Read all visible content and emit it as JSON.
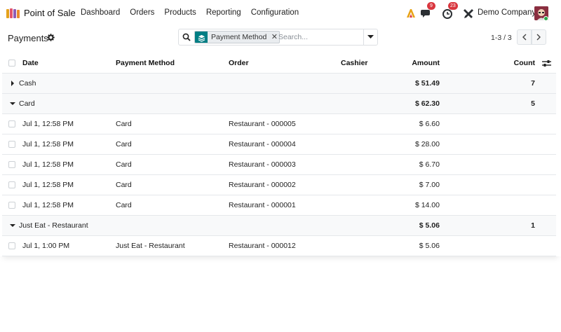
{
  "app": {
    "name": "Point of Sale",
    "menu": [
      "Dashboard",
      "Orders",
      "Products",
      "Reporting",
      "Configuration"
    ]
  },
  "systray": {
    "messages_badge": "9",
    "activities_badge": "23",
    "company": "Demo Company"
  },
  "control_panel": {
    "title": "Payments",
    "search": {
      "facet_label": "Payment Method",
      "placeholder": "Search..."
    },
    "pager": "1-3 / 3"
  },
  "list": {
    "columns": {
      "date": "Date",
      "payment_method": "Payment Method",
      "order": "Order",
      "cashier": "Cashier",
      "amount": "Amount",
      "count": "Count"
    },
    "groups": [
      {
        "name": "Cash",
        "expanded": false,
        "amount": "$ 51.49",
        "count": "7",
        "records": []
      },
      {
        "name": "Card",
        "expanded": true,
        "amount": "$ 62.30",
        "count": "5",
        "records": [
          {
            "date": "Jul 1, 12:58 PM",
            "method": "Card",
            "order": "Restaurant - 000005",
            "amount": "$ 6.60"
          },
          {
            "date": "Jul 1, 12:58 PM",
            "method": "Card",
            "order": "Restaurant - 000004",
            "amount": "$ 28.00"
          },
          {
            "date": "Jul 1, 12:58 PM",
            "method": "Card",
            "order": "Restaurant - 000003",
            "amount": "$ 6.70"
          },
          {
            "date": "Jul 1, 12:58 PM",
            "method": "Card",
            "order": "Restaurant - 000002",
            "amount": "$ 7.00"
          },
          {
            "date": "Jul 1, 12:58 PM",
            "method": "Card",
            "order": "Restaurant - 000001",
            "amount": "$ 14.00"
          }
        ]
      },
      {
        "name": "Just Eat - Restaurant",
        "expanded": true,
        "amount": "$ 5.06",
        "count": "1",
        "records": [
          {
            "date": "Jul 1, 1:00 PM",
            "method": "Just Eat - Restaurant",
            "order": "Restaurant - 000012",
            "amount": "$ 5.06"
          }
        ]
      }
    ]
  },
  "colors": {
    "brand": "#017e84",
    "badge": "#d9363e",
    "online": "#28a745"
  },
  "icons": {
    "app_logo": "pos-books-icon",
    "gear": "gear-icon",
    "search": "search-icon",
    "facet": "layers-icon",
    "collapsed": "caret-right-icon",
    "expanded": "caret-down-icon",
    "settings": "sliders-icon"
  }
}
